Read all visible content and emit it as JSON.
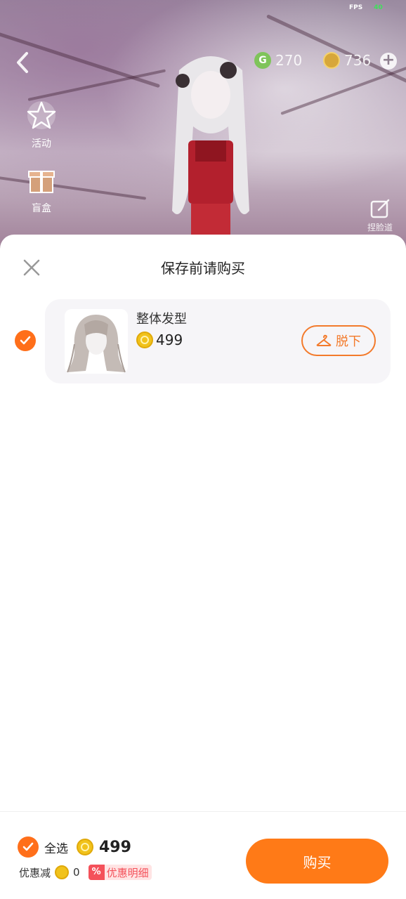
{
  "status": {
    "fps_label": "FPS",
    "fps_value": "40"
  },
  "header": {
    "currency_g": {
      "icon": "g-coin-icon",
      "value": "270"
    },
    "currency_coin": {
      "icon": "coin-icon",
      "value": "736"
    }
  },
  "side_menu": [
    {
      "icon": "star-icon",
      "label": "活动"
    },
    {
      "icon": "gift-box-icon",
      "label": "盲盒"
    }
  ],
  "pinch_face": {
    "icon": "edit-icon",
    "label": "捏脸道"
  },
  "sheet": {
    "title": "保存前请购买",
    "item": {
      "name": "整体发型",
      "price": "499",
      "takeoff_label": "脱下",
      "checked": true
    }
  },
  "footer": {
    "select_all_label": "全选",
    "total": "499",
    "discount_label": "优惠减",
    "discount_value": "0",
    "promo_icon": "%",
    "promo_label": "优惠明细",
    "buy_label": "购买"
  },
  "colors": {
    "accent": "#ff7a17",
    "check": "#ff6f1a",
    "promo": "#f4515a"
  }
}
